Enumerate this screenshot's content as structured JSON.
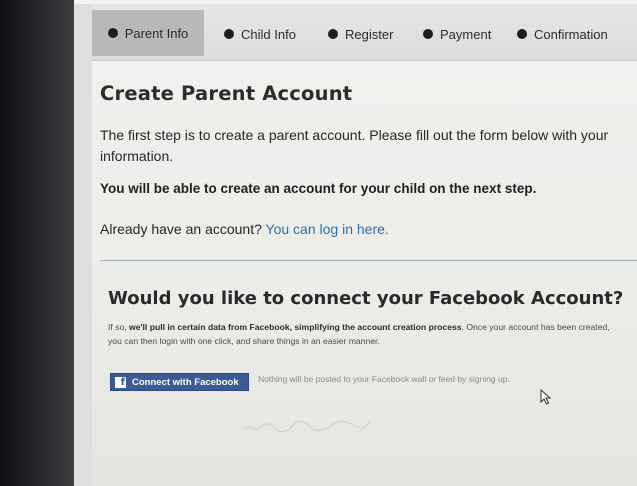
{
  "steps": [
    {
      "label": "Parent Info",
      "active": true
    },
    {
      "label": "Child Info"
    },
    {
      "label": "Register"
    },
    {
      "label": "Payment"
    },
    {
      "label": "Confirmation"
    }
  ],
  "page": {
    "title": "Create Parent Account",
    "intro": "The first step is to create a parent account. Please fill out the form below with your information.",
    "note": "You will be able to create an account for your child on the next step.",
    "login_prompt": "Already have an account?",
    "login_link": "You can log in here."
  },
  "facebook": {
    "heading": "Would you like to connect your Facebook Account?",
    "desc_prefix": "If so,",
    "desc_bold": "we'll pull in certain data from Facebook, simplifying the account creation process",
    "desc_suffix": ". Once your account has been created, you can then login with one click, and share things in an easier manner.",
    "button_label": "Connect with Facebook",
    "button_icon": "facebook-icon",
    "note": "Nothing will be posted to your Facebook wall or feed by signing up."
  },
  "colors": {
    "facebook_blue": "#3b5a96",
    "link_blue": "#2f6fa8",
    "active_step_bg": "#b8b8b6"
  }
}
